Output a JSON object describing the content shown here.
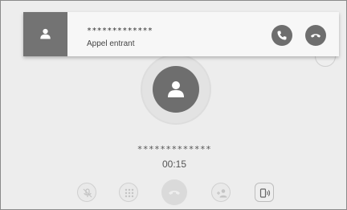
{
  "banner": {
    "caller_name": "*************",
    "status": "Appel entrant",
    "answer_icon": "phone-answer-icon",
    "decline_icon": "phone-hangup-icon"
  },
  "call": {
    "caller_name": "*************",
    "duration": "00:15"
  },
  "controls": [
    {
      "name": "mute-button",
      "icon": "mic-off-icon"
    },
    {
      "name": "keypad-button",
      "icon": "keypad-icon"
    },
    {
      "name": "end-call-button",
      "icon": "phone-hangup-icon"
    },
    {
      "name": "add-call-button",
      "icon": "add-person-icon"
    },
    {
      "name": "audio-transfer-button",
      "icon": "phone-speaker-icon"
    }
  ],
  "colors": {
    "background": "#ededed",
    "banner": "#f7f7f7",
    "accent_gray": "#6e6e6e"
  }
}
